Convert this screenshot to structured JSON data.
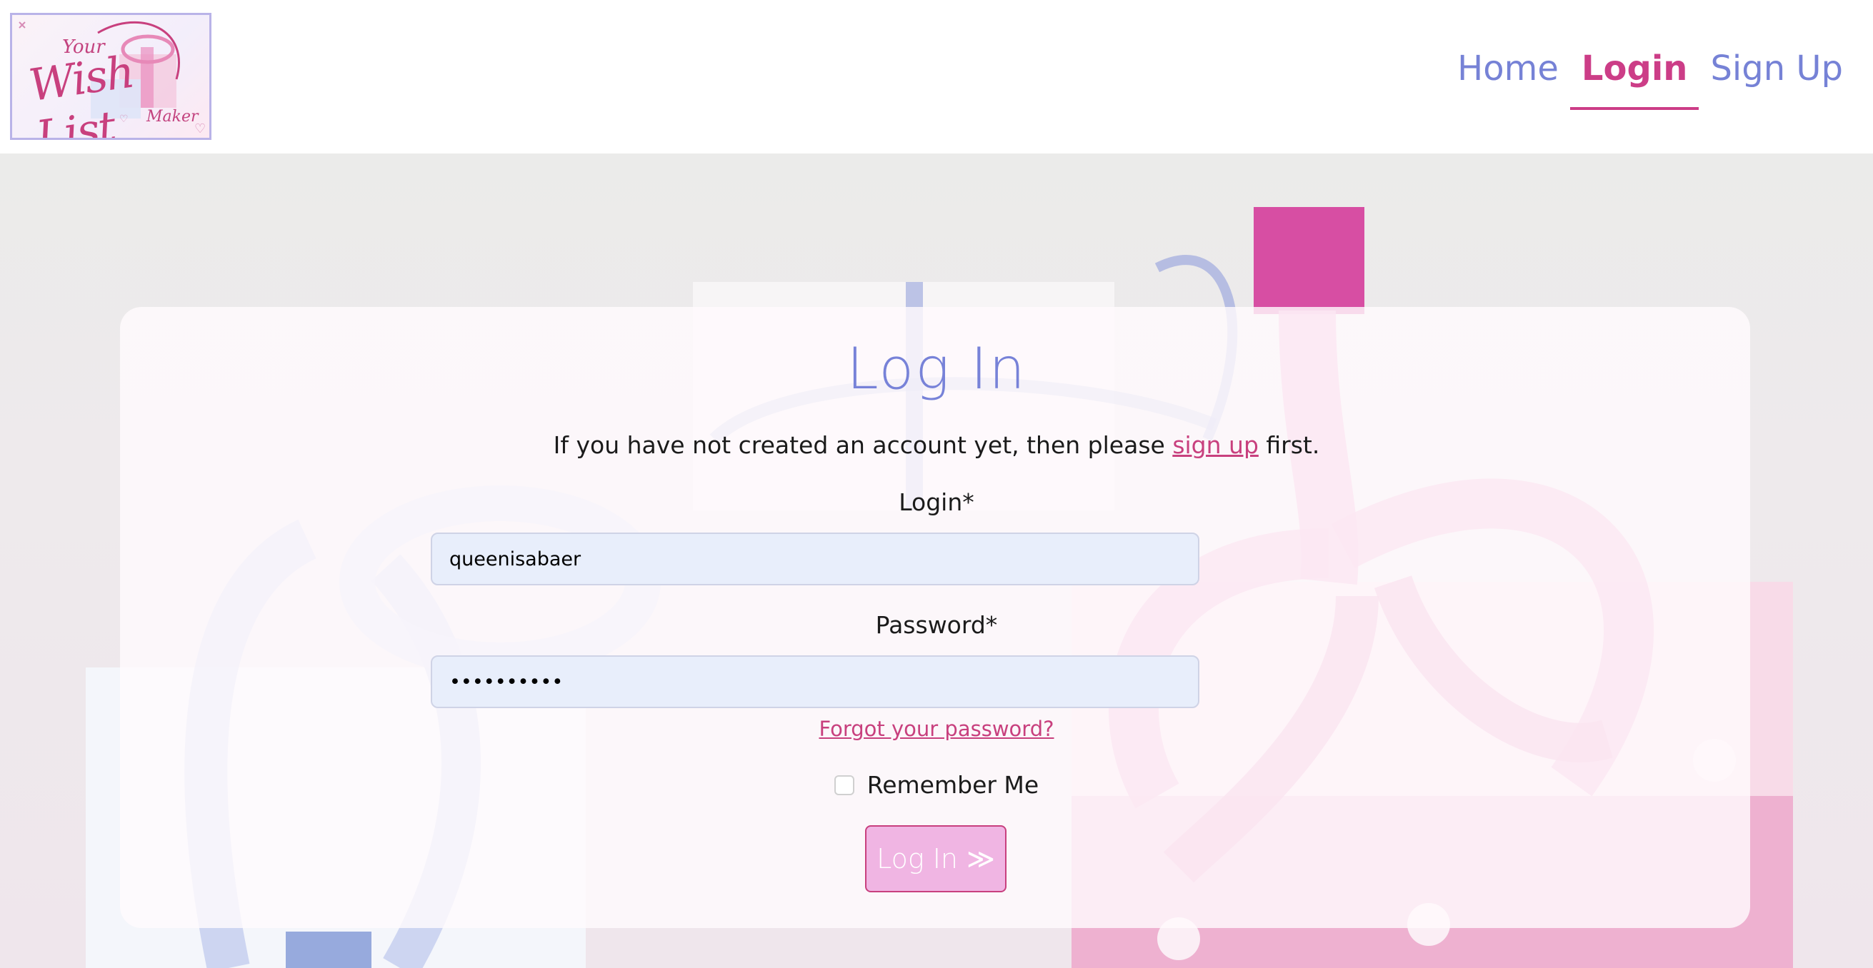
{
  "header": {
    "logo": {
      "line1": "Your",
      "line2": "Wish List",
      "line3": "Maker"
    },
    "nav": [
      {
        "label": "Home",
        "active": false
      },
      {
        "label": "Login",
        "active": true
      },
      {
        "label": "Sign Up",
        "active": false
      }
    ]
  },
  "login_card": {
    "title": "Log In",
    "subtitle_prefix": "If you have not created an account yet, then please ",
    "subtitle_link": "sign up",
    "subtitle_suffix": " first.",
    "login_label": "Login*",
    "login_value": "queenisabaer",
    "password_label": "Password*",
    "password_value": "••••••••••",
    "forgot_link": "Forgot your password?",
    "remember_label": "Remember Me",
    "submit_label": "Log In ≫"
  },
  "colors": {
    "primary_pink": "#cc3d87",
    "nav_blue": "#7682d6",
    "button_fill": "#f0b5e3",
    "input_fill": "#e8eefb"
  }
}
